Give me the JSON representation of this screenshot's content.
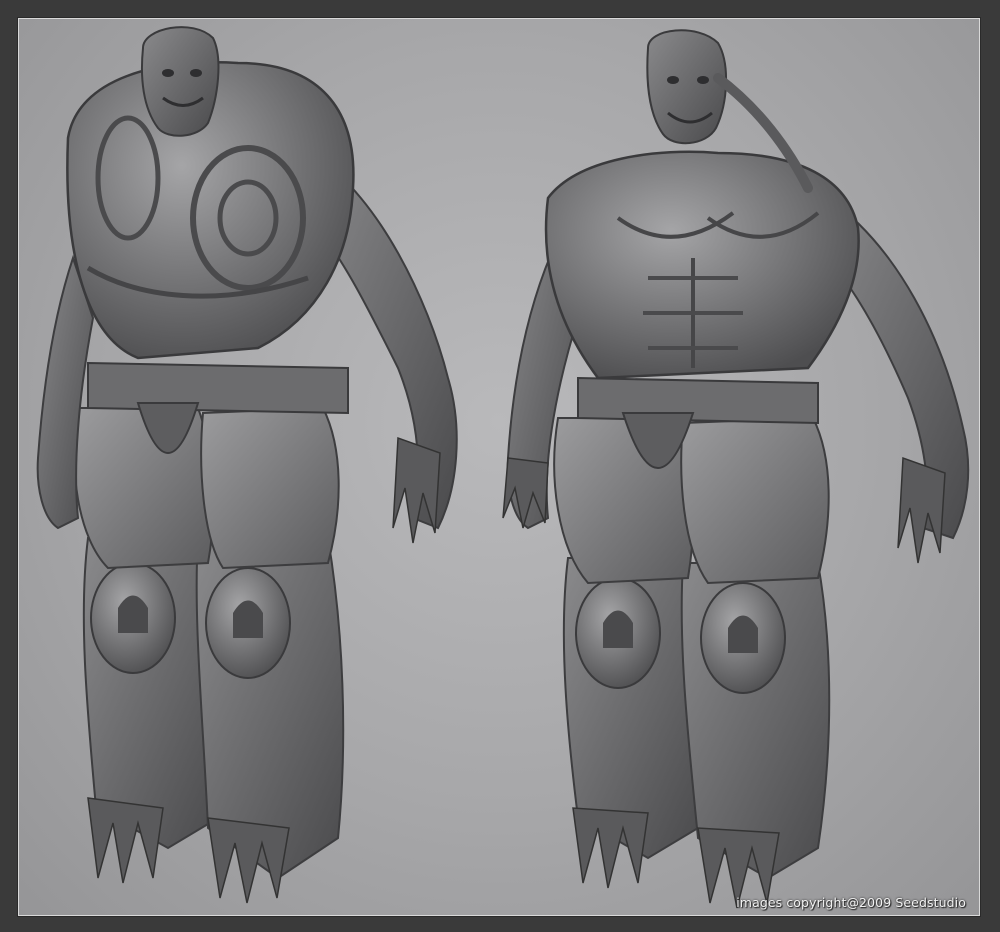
{
  "image": {
    "description_icon": "sculpt-render",
    "background_color": "#a9a9ab",
    "frame_color": "#3a3a3a",
    "figures": [
      {
        "name": "armored-creature-figure",
        "icon": "armored-monster-icon"
      },
      {
        "name": "bare-torso-creature-figure",
        "icon": "muscular-monster-icon"
      }
    ]
  },
  "watermark": {
    "text": "images copyright@2009 Seedstudio"
  }
}
